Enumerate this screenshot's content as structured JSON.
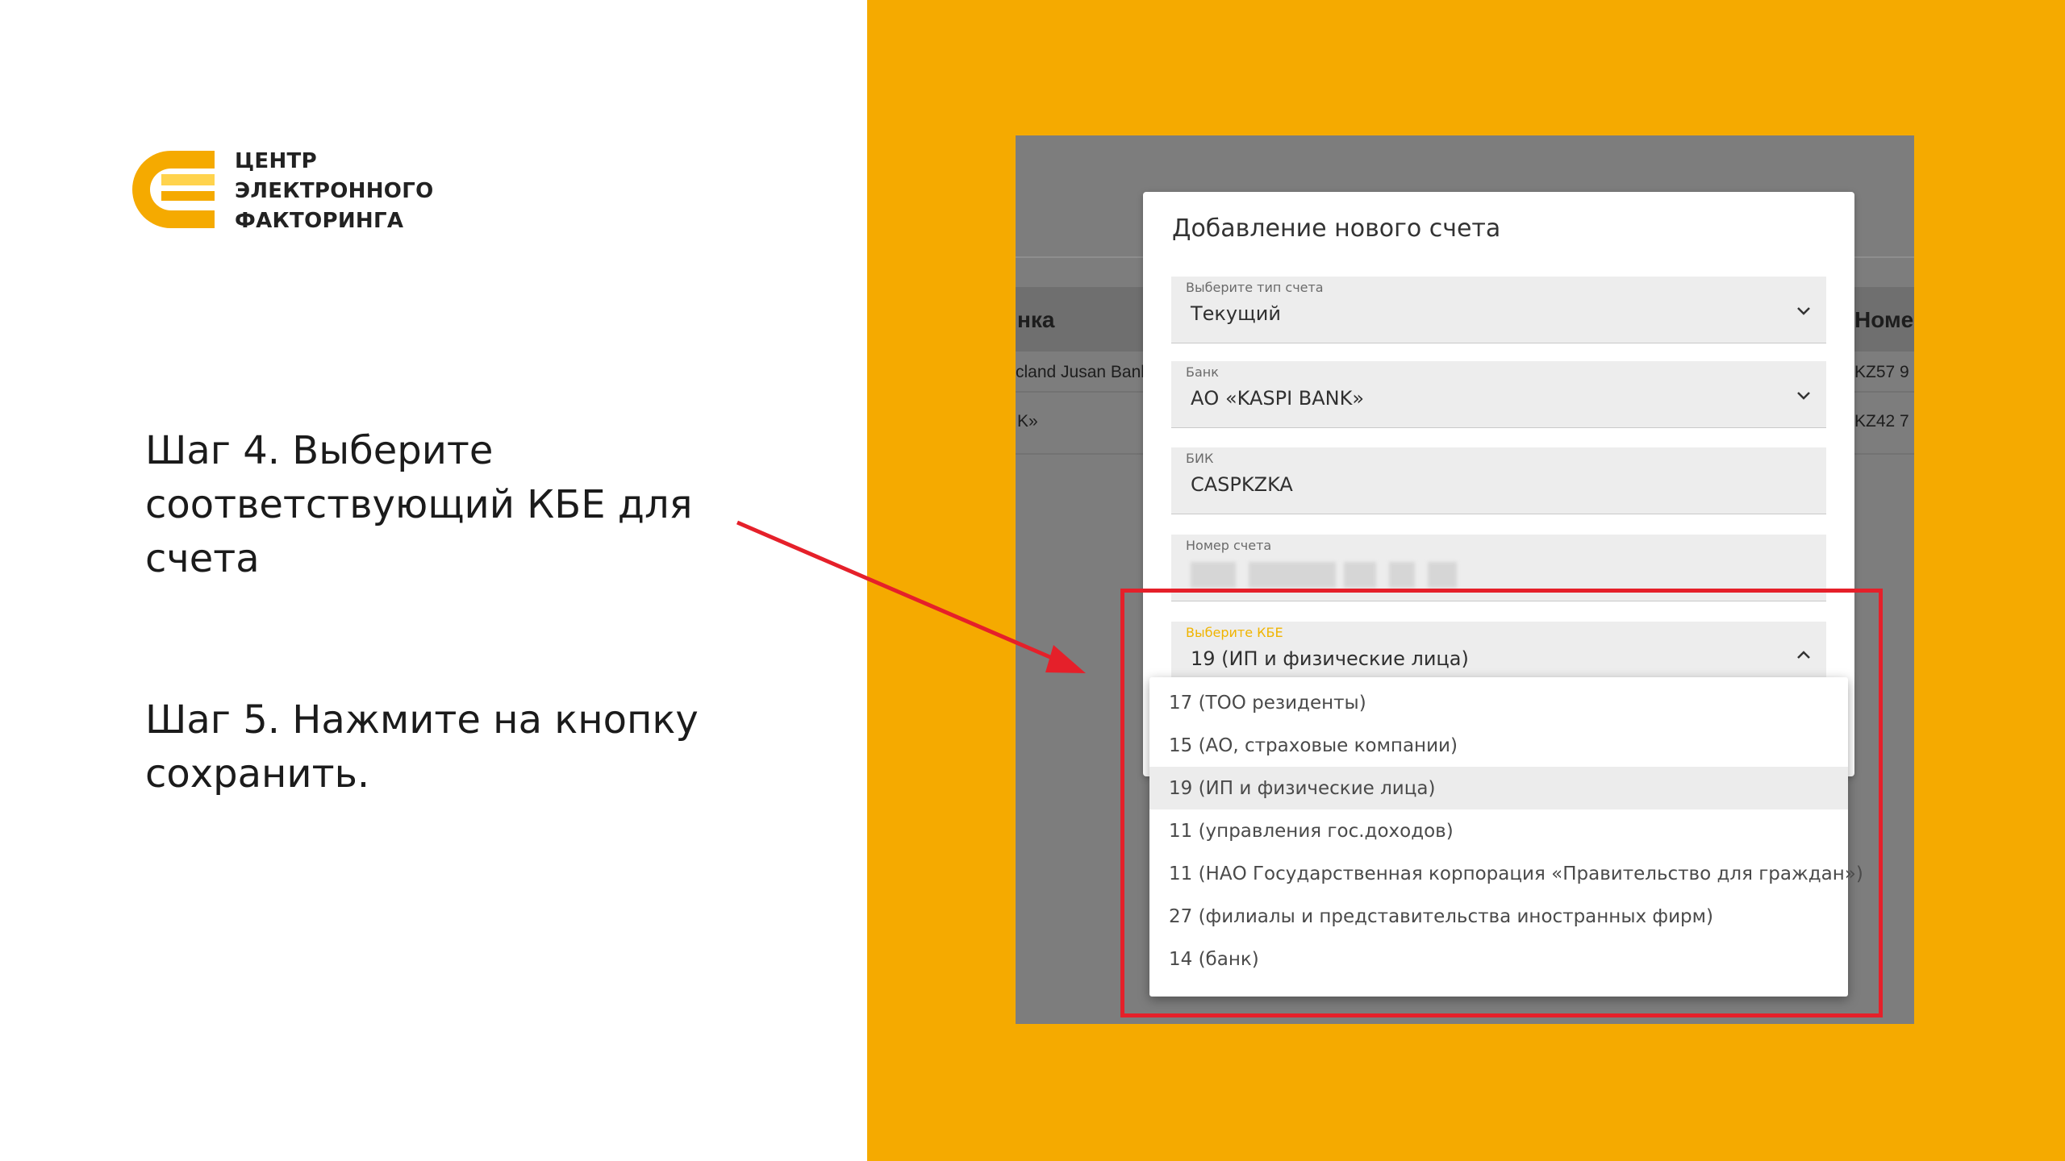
{
  "logo": {
    "line1": "ЦЕНТР",
    "line2": "ЭЛЕКТРОННОГО",
    "line3": "ФАКТОРИНГА",
    "colors": {
      "primary": "#f5aa00",
      "light": "#ffd34d"
    }
  },
  "steps": {
    "step4": "Шаг 4.  Выберите соответствующий КБЕ для счета",
    "step5": "Шаг 5.  Нажмите на кнопку сохранить."
  },
  "background_table": {
    "header_col1": "нка",
    "header_col2": "Номер",
    "row1_col1": "cland Jusan Bank",
    "row1_col2": "KZ57 9",
    "row2_col1": "K»",
    "row2_col2": "KZ42 7"
  },
  "modal": {
    "title": "Добавление нового счета",
    "account_type": {
      "label": "Выберите тип счета",
      "value": "Текущий"
    },
    "bank": {
      "label": "Банк",
      "value": "АО «KASPI BANK»"
    },
    "bik": {
      "label": "БИК",
      "value": "CASPKZKA"
    },
    "account_number": {
      "label": "Номер счета"
    },
    "kbe": {
      "label": "Выберите КБЕ",
      "value": "19 (ИП и физические лица)"
    }
  },
  "kbe_options": [
    "17 (ТОО резиденты)",
    "15 (АО, страховые компании)",
    "19 (ИП и физические лица)",
    "11 (управления гос.доходов)",
    "11 (НАО Государственная корпорация «Правительство для граждан»)",
    "27 (филиалы и представительства иностранных фирм)",
    "14 (банк)"
  ],
  "selected_index": 2,
  "colors": {
    "accent_yellow": "#f5aa00",
    "highlight_red": "#e5202a",
    "selected_item_bg": "#ececec"
  }
}
